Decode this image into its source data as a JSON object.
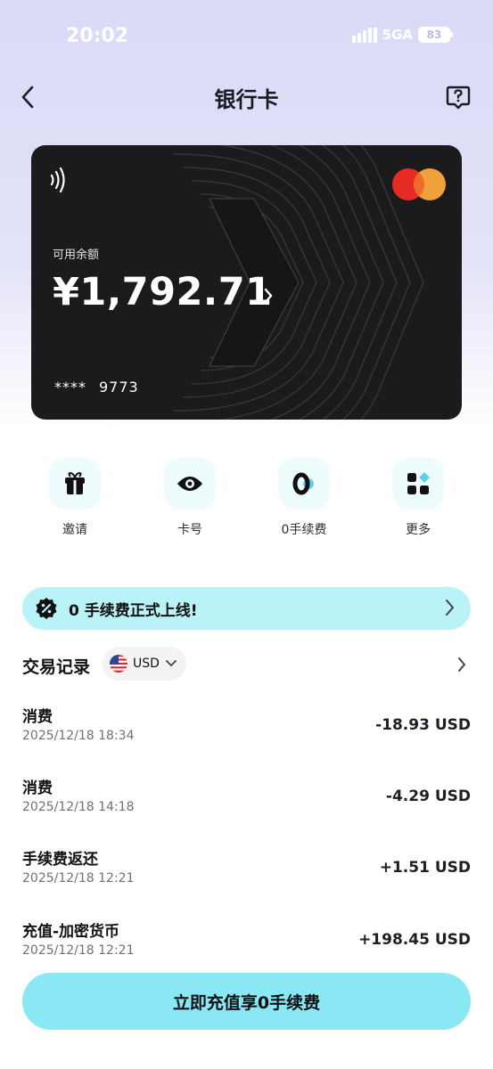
{
  "status": {
    "time": "20:02",
    "network": "5GA",
    "battery": "83"
  },
  "nav": {
    "title": "银行卡"
  },
  "card": {
    "balance_label": "可用余额",
    "balance": "¥1,792.71",
    "number_mask": "****",
    "last4": "9773"
  },
  "actions": [
    {
      "label": "邀请",
      "icon": "gift-icon"
    },
    {
      "label": "卡号",
      "icon": "eye-icon"
    },
    {
      "label": "0手续费",
      "icon": "zero-fee-icon"
    },
    {
      "label": "更多",
      "icon": "apps-grid-icon"
    }
  ],
  "banner": {
    "text": "0 手续费正式上线!"
  },
  "transactions_header": {
    "title": "交易记录",
    "currency": "USD"
  },
  "transactions": [
    {
      "name": "消费",
      "date": "2025/12/18 18:34",
      "amount": "-18.93 USD"
    },
    {
      "name": "消费",
      "date": "2025/12/18 14:18",
      "amount": "-4.29 USD"
    },
    {
      "name": "手续费返还",
      "date": "2025/12/18 12:21",
      "amount": "+1.51 USD"
    },
    {
      "name": "充值-加密货币",
      "date": "2025/12/18 12:21",
      "amount": "+198.45 USD"
    }
  ],
  "cta": {
    "label": "立即充值享0手续费"
  },
  "colors": {
    "accent": "#8ae8f5",
    "banner": "#b9f3f7",
    "card": "#1b1b1d"
  }
}
